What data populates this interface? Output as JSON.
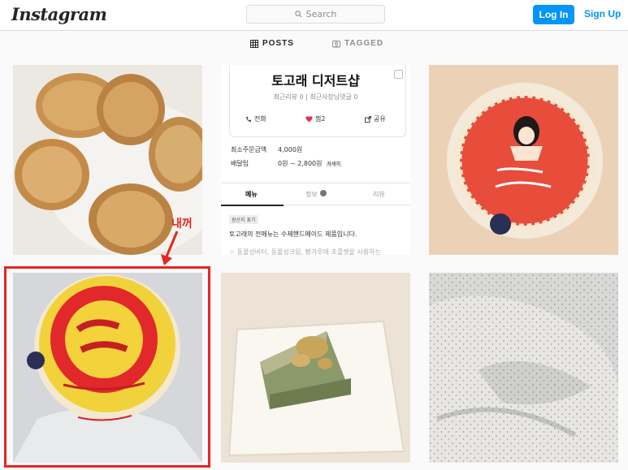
{
  "header": {
    "logo": "Instagram",
    "search_placeholder": "Search",
    "login_label": "Log In",
    "signup_label": "Sign Up"
  },
  "tabs": [
    {
      "label": "POSTS",
      "active": true,
      "icon": "grid-icon"
    },
    {
      "label": "TAGGED",
      "active": false,
      "icon": "tag-icon"
    }
  ],
  "posts": [
    {
      "description": "scones"
    },
    {
      "description": "menu card"
    },
    {
      "description": "pink cake"
    },
    {
      "description": "red cake"
    },
    {
      "description": "cake slice"
    },
    {
      "description": "cream"
    }
  ],
  "menu_card": {
    "shop_name": "토고래 디저트샵",
    "stats": "최근리뷰 0  |  최근사장님댓글 0",
    "actions": {
      "call": "전화",
      "like": "찜2",
      "share": "공유"
    },
    "min_order_label": "최소주문금액",
    "min_order_value": "4,000원",
    "delivery_label": "배달팁",
    "delivery_value": "0원 ~ 2,800원",
    "delivery_detail": "자세히",
    "tabs": [
      "메뉴",
      "정보",
      "리뷰"
    ],
    "tag": "원산지 표기",
    "desc_line1": "토고래의 전메뉴는 수제핸드메이드 제품입니다.",
    "desc_line2": "☆ 동물성버터, 동물성크림, 빵가루에 초콜렛을 사용하는"
  },
  "annotation": {
    "text": "내꺼",
    "color": "#e8251f"
  },
  "colors": {
    "accent": "#0095f6",
    "highlight": "#e8251f"
  }
}
